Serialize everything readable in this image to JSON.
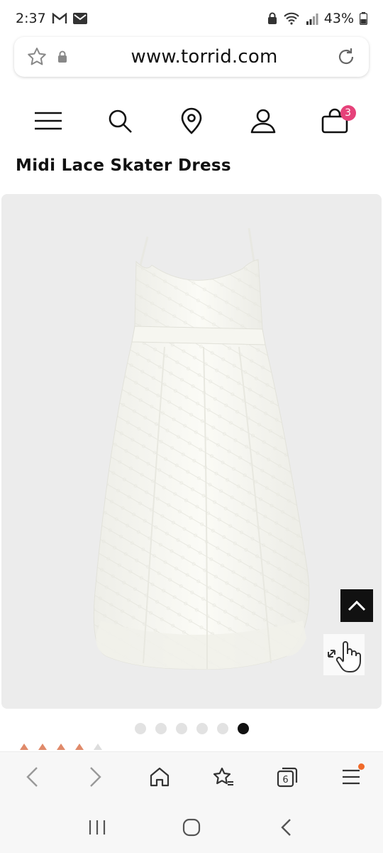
{
  "status_bar": {
    "time": "2:37",
    "battery": "43%",
    "icons": [
      "gmail-icon",
      "mail-icon",
      "lock-icon",
      "wifi-icon",
      "signal-icon",
      "battery-icon"
    ]
  },
  "browser": {
    "url": "www.torrid.com",
    "icons": [
      "star-icon",
      "lock-icon",
      "reload-icon"
    ],
    "tab_count": "6"
  },
  "site_header": {
    "icons": [
      "menu-icon",
      "search-icon",
      "store-locator-icon",
      "account-icon",
      "bag-icon"
    ],
    "bag_count": "3",
    "accent": "#e6427a"
  },
  "product": {
    "title": "Midi Lace Skater Dress",
    "image_count": 6,
    "active_image": 6,
    "rating_stars_filled": 4
  },
  "bottom_nav": {
    "items": [
      "back-icon",
      "forward-icon",
      "home-icon",
      "bookmarks-icon",
      "tabs-icon",
      "menu-icon"
    ]
  },
  "android_nav": {
    "items": [
      "recent-apps-icon",
      "home-icon",
      "back-icon"
    ]
  }
}
